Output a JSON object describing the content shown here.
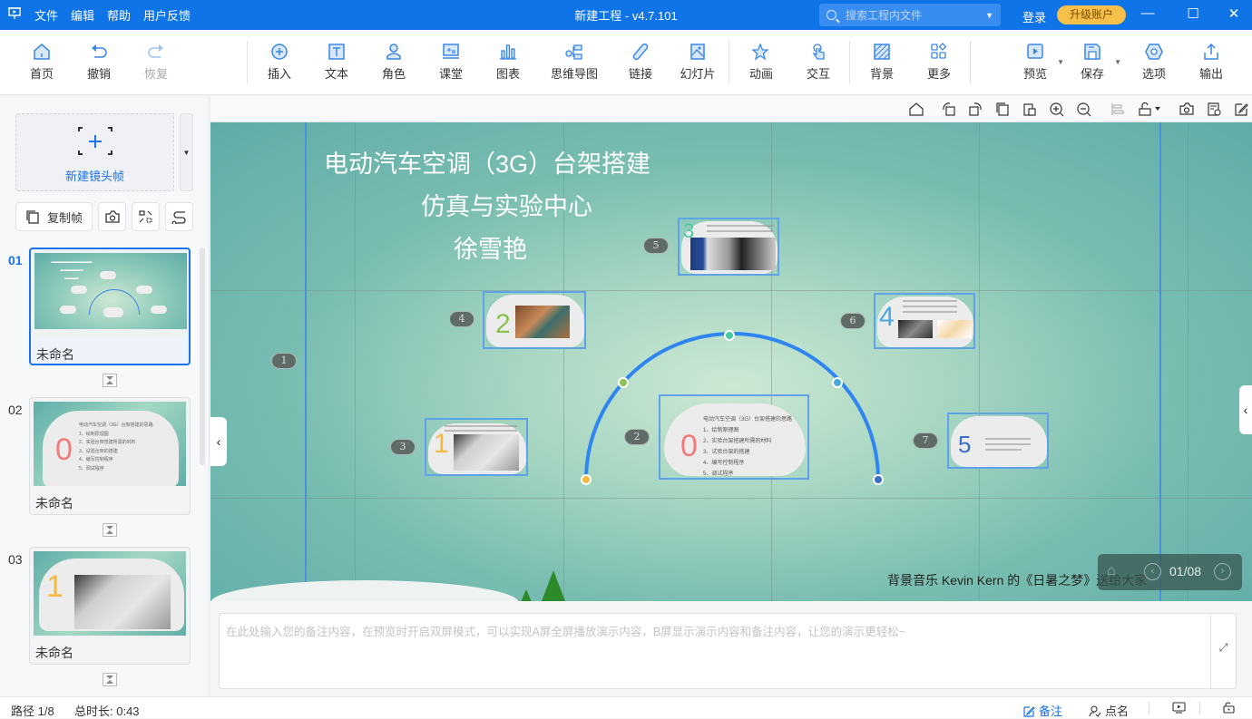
{
  "titlebar": {
    "app_icon": "presentation-icon",
    "menu": [
      "文件",
      "编辑",
      "帮助",
      "用户反馈"
    ],
    "title": "新建工程 - v4.7.101",
    "search_placeholder": "搜索工程内文件",
    "login": "登录",
    "upgrade": "升级账户",
    "minimize": "—",
    "maximize": "☐",
    "close": "✕"
  },
  "toolbar": {
    "items": [
      {
        "label": "首页",
        "icon": "home-icon"
      },
      {
        "label": "撤销",
        "icon": "undo-icon"
      },
      {
        "label": "恢复",
        "icon": "redo-icon",
        "disabled": true
      },
      {
        "label": "插入",
        "icon": "insert-icon"
      },
      {
        "label": "文本",
        "icon": "text-icon"
      },
      {
        "label": "角色",
        "icon": "character-icon"
      },
      {
        "label": "课堂",
        "icon": "classroom-icon"
      },
      {
        "label": "图表",
        "icon": "chart-icon"
      },
      {
        "label": "思维导图",
        "icon": "mindmap-icon"
      },
      {
        "label": "链接",
        "icon": "link-icon"
      },
      {
        "label": "幻灯片",
        "icon": "slide-icon"
      },
      {
        "label": "动画",
        "icon": "animation-icon"
      },
      {
        "label": "交互",
        "icon": "interaction-icon"
      },
      {
        "label": "背景",
        "icon": "background-icon"
      },
      {
        "label": "更多",
        "icon": "more-icon"
      },
      {
        "label": "预览",
        "icon": "preview-icon"
      },
      {
        "label": "保存",
        "icon": "save-icon"
      },
      {
        "label": "选项",
        "icon": "options-icon"
      },
      {
        "label": "输出",
        "icon": "export-icon"
      }
    ]
  },
  "sidebar": {
    "new_frame": "新建镜头帧",
    "copy_frame": "复制帧",
    "frames": [
      {
        "num": "01",
        "name": "未命名",
        "active": true
      },
      {
        "num": "02",
        "name": "未命名",
        "active": false
      },
      {
        "num": "03",
        "name": "未命名",
        "active": false
      }
    ],
    "thumb2": {
      "digit": "0",
      "heading": "电动汽车空调（3G）台架搭建的思路",
      "lines": [
        "1、绘制原理图",
        "2、实验台架搭建所需的材料",
        "3、试验台架的搭建",
        "4、编写控制程序",
        "5、调试程序"
      ]
    },
    "thumb3": {
      "digit": "1"
    }
  },
  "canvas_toolbar": [
    "home-icon",
    "rotate-left-icon",
    "rotate-right-icon",
    "copy-icon",
    "paste-icon",
    "zoom-in-icon",
    "zoom-out-icon",
    "align-icon",
    "lock-icon",
    "screenshot-icon",
    "schedule-icon",
    "edit-icon"
  ],
  "slide": {
    "title_lines": [
      "电动汽车空调（3G）台架搭建",
      "仿真与实验中心",
      "徐雪艳"
    ],
    "path_badges": [
      "1",
      "2",
      "3",
      "4",
      "5",
      "6",
      "7"
    ],
    "clouds": [
      {
        "digit": "0",
        "color": "#f27a7a",
        "heading": "电动汽车空调（3G）台架搭建的思路",
        "lines": [
          "1、绘制原理图",
          "2、实验台架搭建所需的材料",
          "3、试验台架的搭建",
          "4、编写控制程序",
          "5、调试程序"
        ]
      },
      {
        "digit": "1",
        "color": "#f5b942"
      },
      {
        "digit": "2",
        "color": "#8cc152"
      },
      {
        "digit": "3",
        "color": "#48c9a0"
      },
      {
        "digit": "4",
        "color": "#4aa8e0"
      },
      {
        "digit": "5",
        "color": "#3b6fc7"
      }
    ],
    "background_music": "背景音乐 Kevin Kern 的《日暑之梦》送给大家"
  },
  "pager": {
    "current": "01/08"
  },
  "notes": {
    "placeholder": "在此处输入您的备注内容，在预览时开启双屏模式，可以实现A屏全屏播放演示内容，B屏显示演示内容和备注内容，让您的演示更轻松~"
  },
  "statusbar": {
    "path": "路径 1/8",
    "duration": "总时长: 0:43",
    "notes": "备注",
    "rollcall": "点名"
  }
}
